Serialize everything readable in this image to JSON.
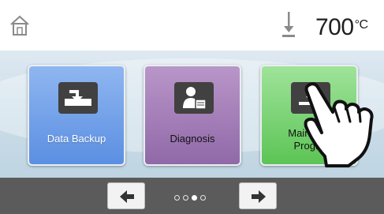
{
  "status_bar": {
    "home_icon": "home-icon",
    "probe_icon": "temperature-probe-icon",
    "temperature_value": "700",
    "temperature_unit": "°C"
  },
  "tiles": [
    {
      "label": "Data Backup",
      "icon": "data-backup-icon",
      "color": "#6d9ee8"
    },
    {
      "label": "Diagnosis",
      "icon": "diagnosis-icon",
      "color": "#9f7bb8"
    },
    {
      "label_line1": "Maintena",
      "label_line2": "Progra",
      "icon": "maintenance-icon",
      "color": "#74d06c"
    }
  ],
  "pager": {
    "prev_icon": "arrow-left-icon",
    "next_icon": "arrow-right-icon",
    "page_count": 4,
    "active_page": 3
  },
  "overlay": {
    "icon": "pointing-hand-icon"
  },
  "colors": {
    "bottom_bar": "#5b5b5b",
    "background": "#cddfea"
  }
}
